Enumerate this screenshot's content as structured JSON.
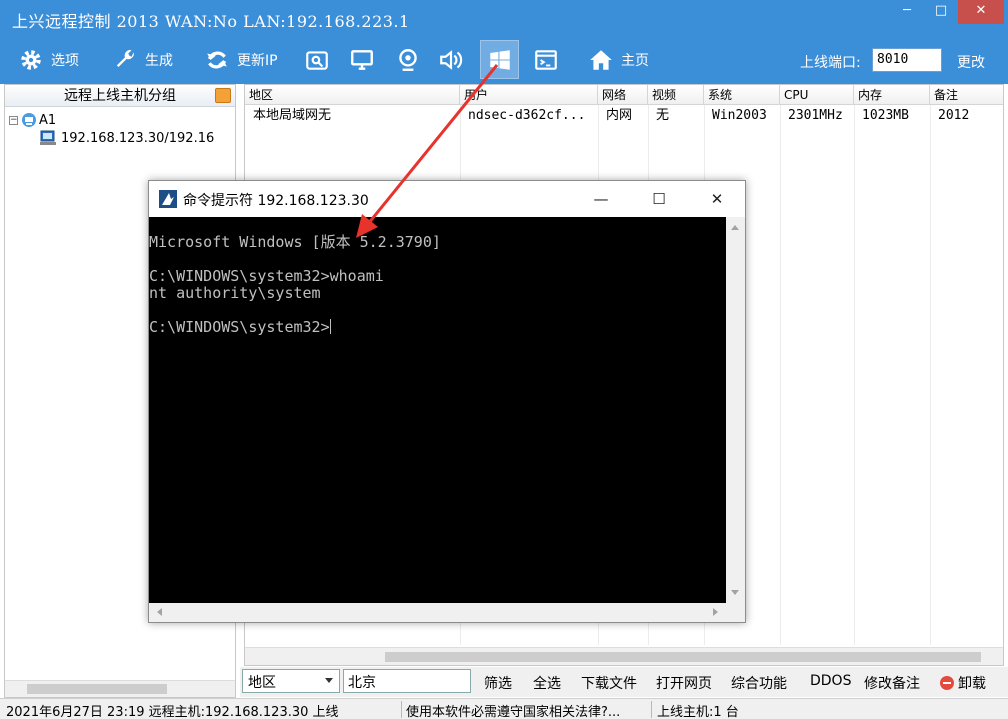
{
  "window": {
    "title": "上兴远程控制 2013 WAN:No LAN:192.168.223.1",
    "controls": {
      "minimize": "─",
      "maximize": "□",
      "close": "✕"
    }
  },
  "toolbar": {
    "items": [
      {
        "label": "选项",
        "icon": "gear-icon"
      },
      {
        "label": "生成",
        "icon": "wrench-icon"
      },
      {
        "label": "更新IP",
        "icon": "refresh-icon"
      },
      {
        "label": "",
        "icon": "folder-search-icon"
      },
      {
        "label": "",
        "icon": "monitor-icon"
      },
      {
        "label": "",
        "icon": "webcam-icon"
      },
      {
        "label": "",
        "icon": "speaker-icon"
      },
      {
        "label": "",
        "icon": "windows-logo-icon",
        "selected": true
      },
      {
        "label": "",
        "icon": "terminal-icon"
      },
      {
        "label": "主页",
        "icon": "home-icon"
      }
    ],
    "port_label": "上线端口:",
    "port_value": "8010",
    "change_label": "更改"
  },
  "left_panel": {
    "header": "远程上线主机分组",
    "group_expander": "−",
    "group_name": "A1",
    "host_entry": "192.168.123.30/192.16"
  },
  "list": {
    "columns": [
      "地区",
      "用户",
      "网络",
      "视频",
      "系统",
      "CPU",
      "内存",
      "备注"
    ],
    "rows": [
      [
        "本地局域网无",
        "ndsec-d362cf...",
        "内网",
        "无",
        "Win2003",
        "2301MHz",
        "1023MB",
        "2012"
      ]
    ]
  },
  "bottom_bar": {
    "filter_field": "地区",
    "filter_value": "北京",
    "buttons": [
      "筛选",
      "全选",
      "下载文件",
      "打开网页",
      "综合功能",
      "DDOS",
      "修改备注",
      "卸载"
    ]
  },
  "status_bar": {
    "left": "2021年6月27日 23:19 远程主机:192.168.123.30 上线",
    "middle": "使用本软件必需遵守国家相关法律?...",
    "right": "上线主机:1 台"
  },
  "cmd_window": {
    "title": "命令提示符 192.168.123.30",
    "controls": {
      "minimize": "—",
      "maximize": "☐",
      "close": "✕"
    },
    "lines": [
      "Microsoft Windows [版本 5.2.3790]",
      "",
      "C:\\WINDOWS\\system32>whoami",
      "nt authority\\system",
      "",
      "C:\\WINDOWS\\system32>"
    ]
  },
  "colors": {
    "titlebar": "#3b8ed8",
    "close": "#c7504d",
    "annotation_arrow": "#e8322c",
    "console_bg": "#000000",
    "console_fg": "#c0c0c0"
  }
}
